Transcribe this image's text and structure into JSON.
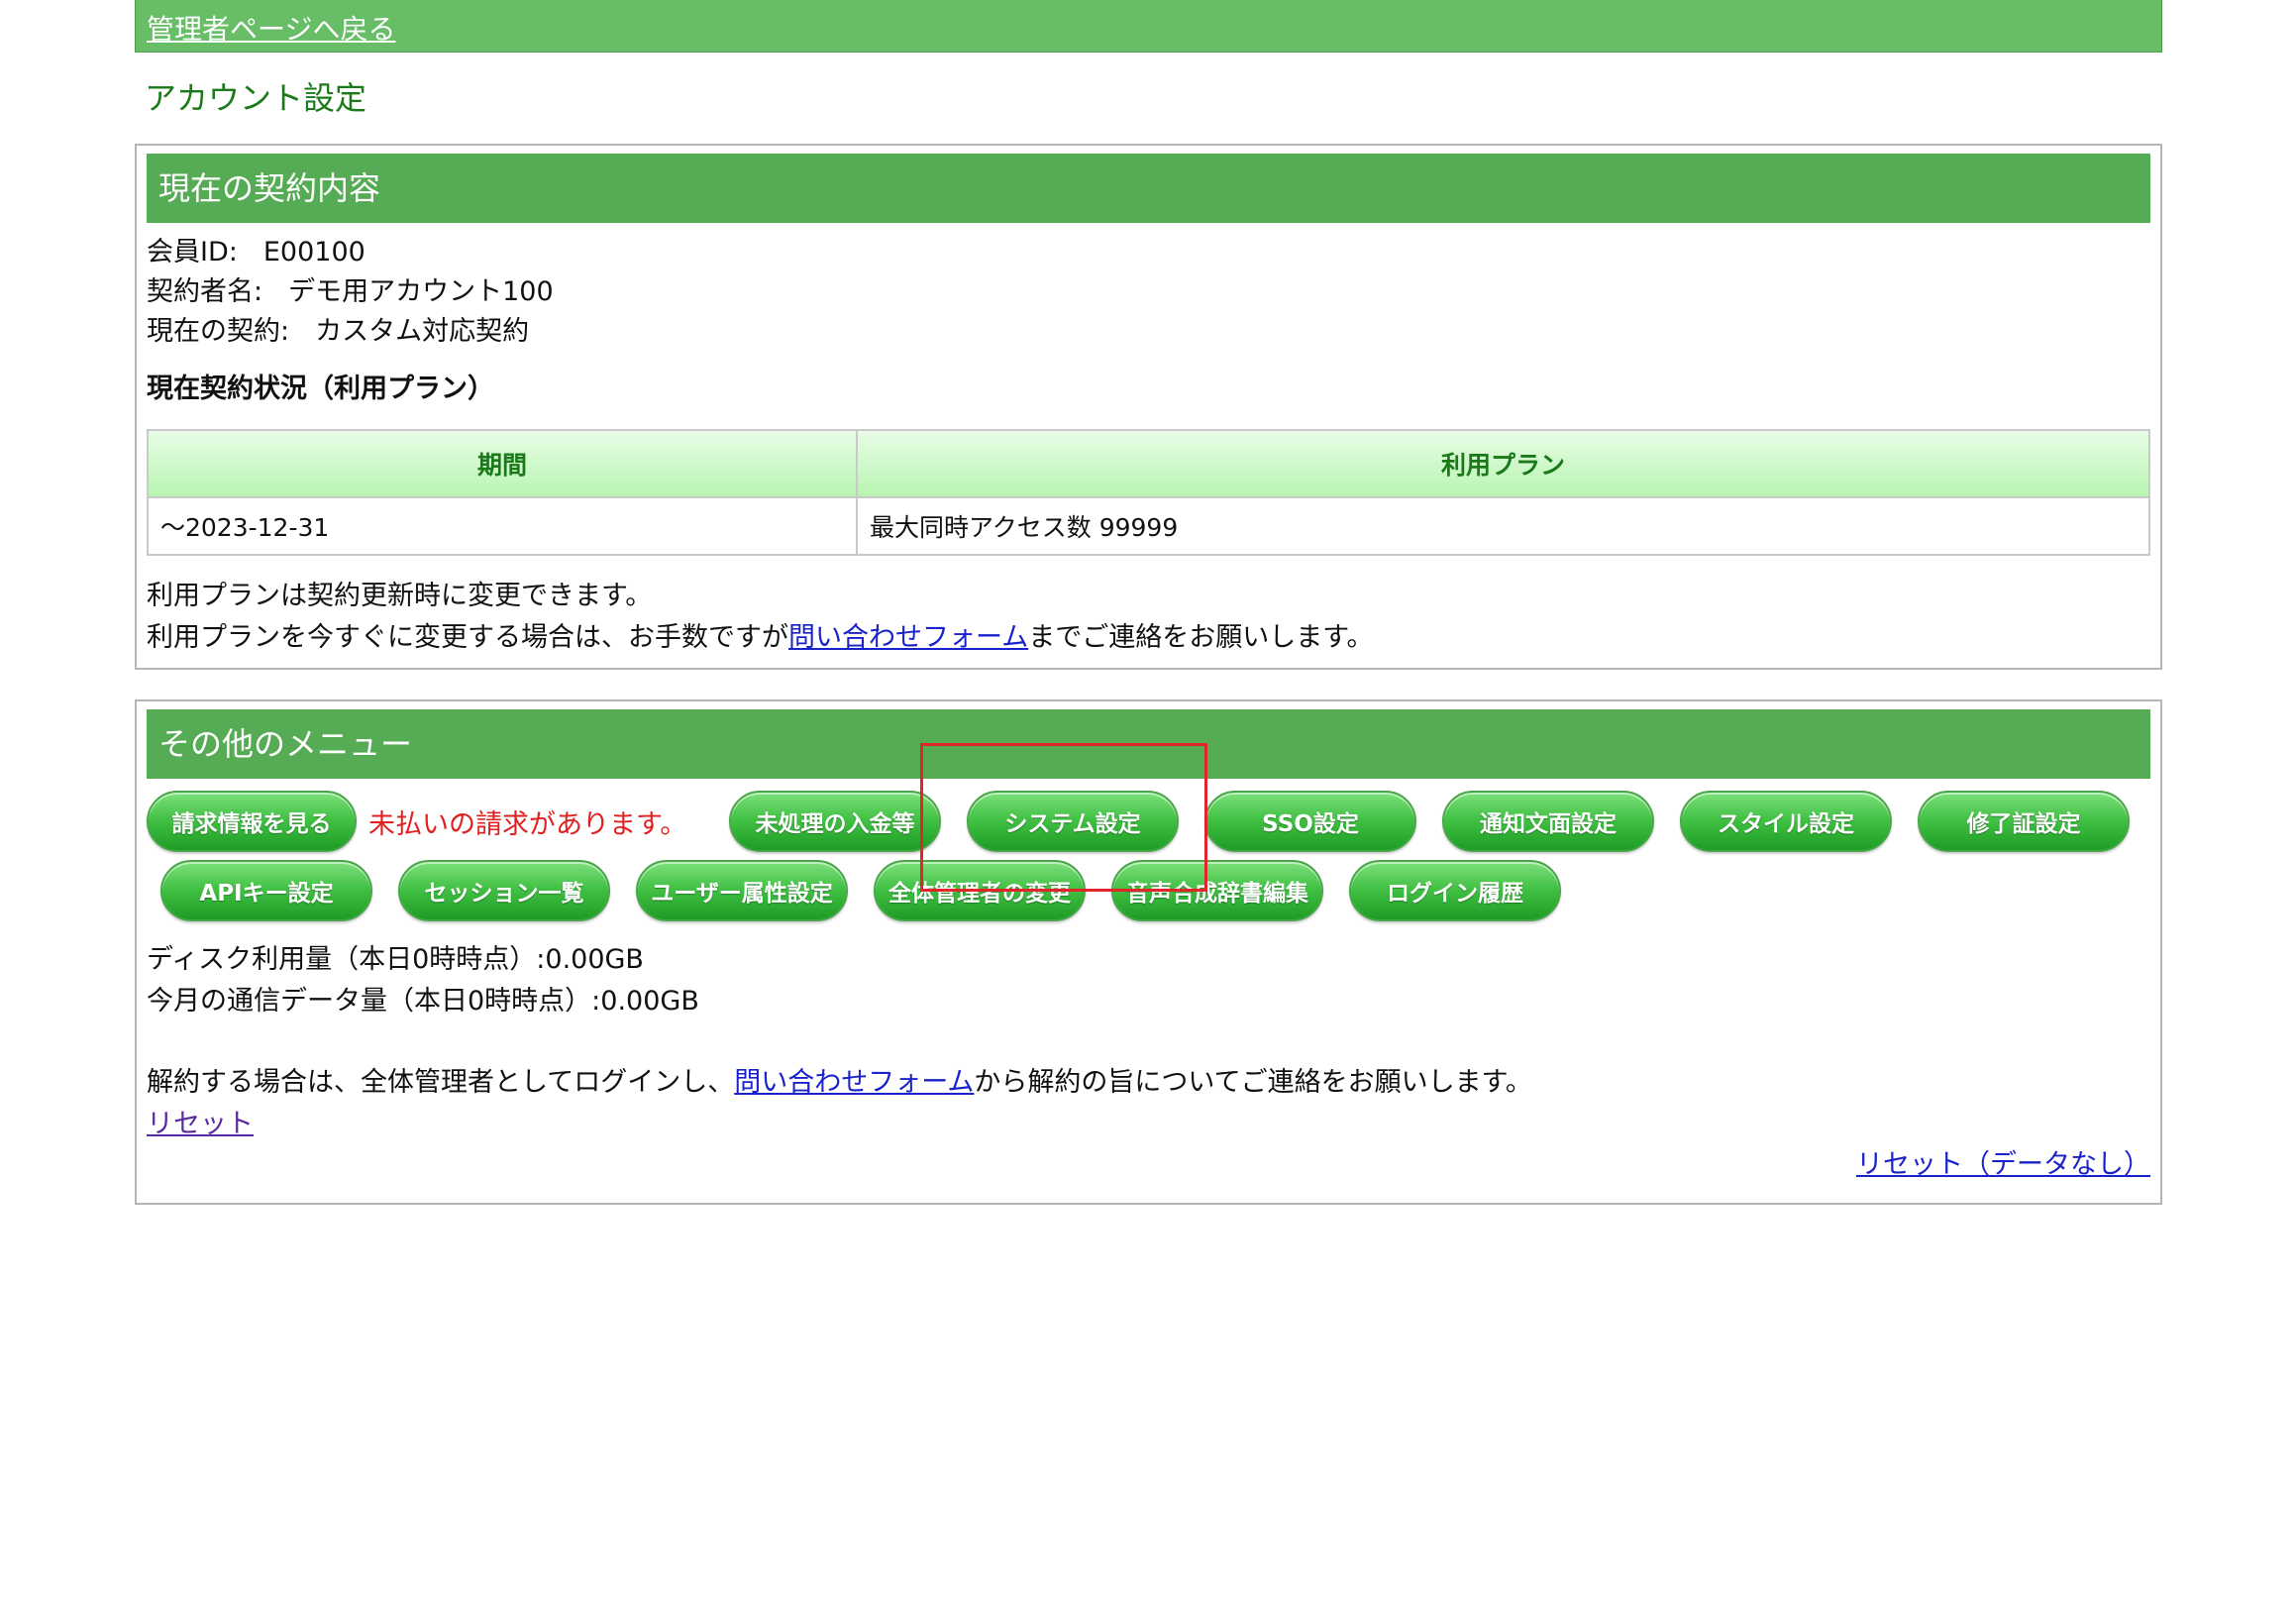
{
  "header": {
    "back_link": "管理者ページへ戻る",
    "page_title": "アカウント設定"
  },
  "contract": {
    "title": "現在の契約内容",
    "member_id_label": "会員ID:",
    "member_id": "E00100",
    "contractor_label": "契約者名:",
    "contractor": "デモ用アカウント100",
    "current_label": "現在の契約:",
    "current": "カスタム対応契約",
    "status_heading": "現在契約状況（利用プラン）",
    "table": {
      "headers": [
        "期間",
        "利用プラン"
      ],
      "rows": [
        [
          "～2023-12-31",
          "最大同時アクセス数 99999"
        ]
      ]
    },
    "note1": "利用プランは契約更新時に変更できます。",
    "note2_pre": "利用プランを今すぐに変更する場合は、お手数ですが",
    "note2_link": "問い合わせフォーム",
    "note2_post": "までご連絡をお願いします。"
  },
  "menu": {
    "title": "その他のメニュー",
    "billing_button": "請求情報を見る",
    "unpaid_notice": "未払いの請求があります。",
    "row1": [
      "未処理の入金等",
      "システム設定",
      "SSO設定",
      "通知文面設定",
      "スタイル設定",
      "修了証設定"
    ],
    "row2": [
      "APIキー設定",
      "セッション一覧",
      "ユーザー属性設定",
      "全体管理者の変更",
      "音声合成辞書編集",
      "ログイン履歴"
    ],
    "disk_usage": "ディスク利用量（本日0時時点）:0.00GB",
    "traffic": "今月の通信データ量（本日0時時点）:0.00GB",
    "cancel_pre": "解約する場合は、全体管理者としてログインし、",
    "cancel_link": "問い合わせフォーム",
    "cancel_post": "から解約の旨についてご連絡をお願いします。",
    "reset_link": "リセット",
    "reset_nodata_link": "リセット（データなし）"
  },
  "colors": {
    "header_green": "#68bd67",
    "panel_green": "#56ab55",
    "button_green": "#43c246",
    "link_blue": "#1a22c9",
    "alert_red": "#e02020",
    "highlight_red": "#e0262b"
  }
}
